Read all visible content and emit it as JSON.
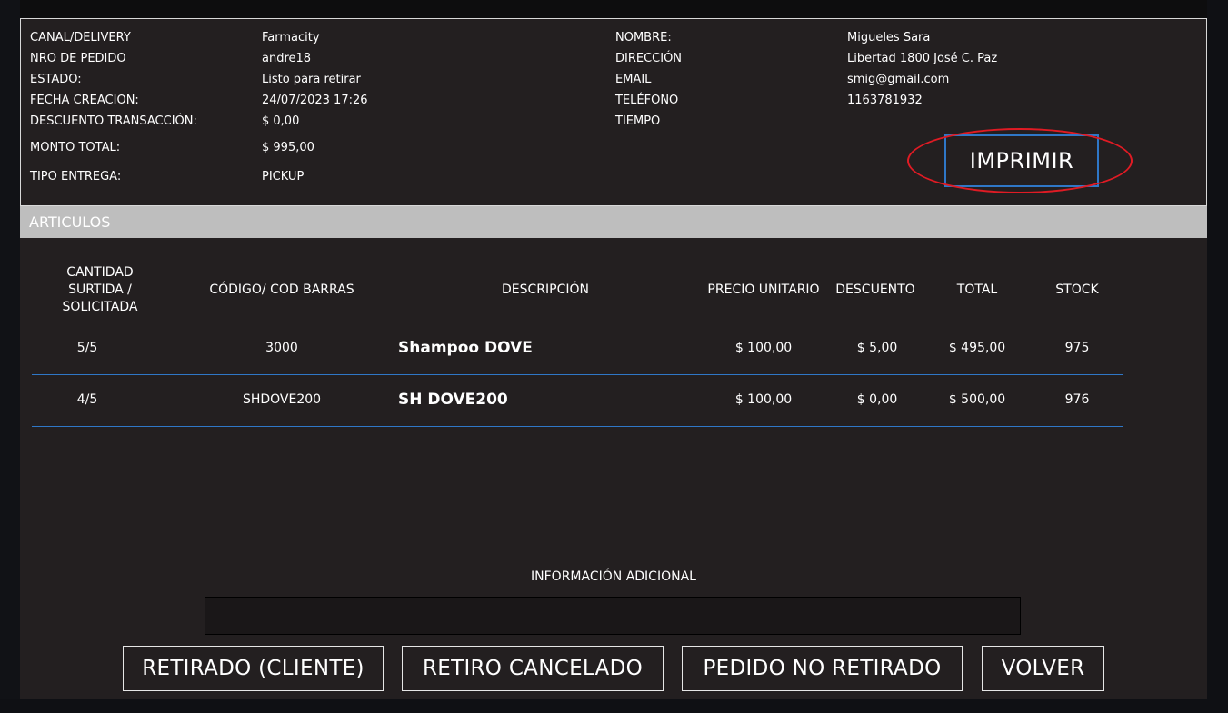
{
  "info": {
    "left": [
      {
        "label": "CANAL/DELIVERY",
        "value": "Farmacity"
      },
      {
        "label": "NRO DE PEDIDO",
        "value": "andre18"
      },
      {
        "label": "ESTADO:",
        "value": "Listo para retirar"
      },
      {
        "label": "FECHA CREACION:",
        "value": "24/07/2023 17:26"
      },
      {
        "label": "DESCUENTO TRANSACCIÓN:",
        "value": "$ 0,00"
      },
      {
        "label": "MONTO TOTAL:",
        "value": "$ 995,00"
      },
      {
        "label": "TIPO ENTREGA:",
        "value": "PICKUP"
      }
    ],
    "right": [
      {
        "label": "NOMBRE:",
        "value": "Migueles Sara"
      },
      {
        "label": "DIRECCIÓN",
        "value": "Libertad 1800 José C. Paz"
      },
      {
        "label": "EMAIL",
        "value": "smig@gmail.com"
      },
      {
        "label": "TELÉFONO",
        "value": "1163781932"
      },
      {
        "label": "TIEMPO",
        "value": ""
      }
    ],
    "print_label": "IMPRIMIR"
  },
  "articles": {
    "title": "ARTICULOS",
    "headers": {
      "cantidad": "CANTIDAD SURTIDA / SOLICITADA",
      "codigo": "CÓDIGO/ COD BARRAS",
      "descripcion": "DESCRIPCIÓN",
      "precio": "PRECIO UNITARIO",
      "descuento": "DESCUENTO",
      "total": "TOTAL",
      "stock": "STOCK"
    },
    "rows": [
      {
        "cantidad": "5/5",
        "codigo": "3000",
        "descripcion": "Shampoo DOVE",
        "precio": "$ 100,00",
        "descuento": "$ 5,00",
        "total": "$ 495,00",
        "stock": "975"
      },
      {
        "cantidad": "4/5",
        "codigo": "SHDOVE200",
        "descripcion": "SH DOVE200",
        "precio": "$ 100,00",
        "descuento": "$ 0,00",
        "total": "$ 500,00",
        "stock": "976"
      }
    ]
  },
  "additional_info": {
    "label": "INFORMACIÓN ADICIONAL",
    "value": ""
  },
  "actions": {
    "retirado": "RETIRADO (CLIENTE)",
    "cancelado": "RETIRO CANCELADO",
    "no_retirado": "PEDIDO NO RETIRADO",
    "volver": "VOLVER"
  },
  "colors": {
    "modal_bg": "#231f20",
    "accent_blue": "#2f77c7",
    "highlight_red": "#e01b24",
    "section_bar": "#bebebe"
  }
}
